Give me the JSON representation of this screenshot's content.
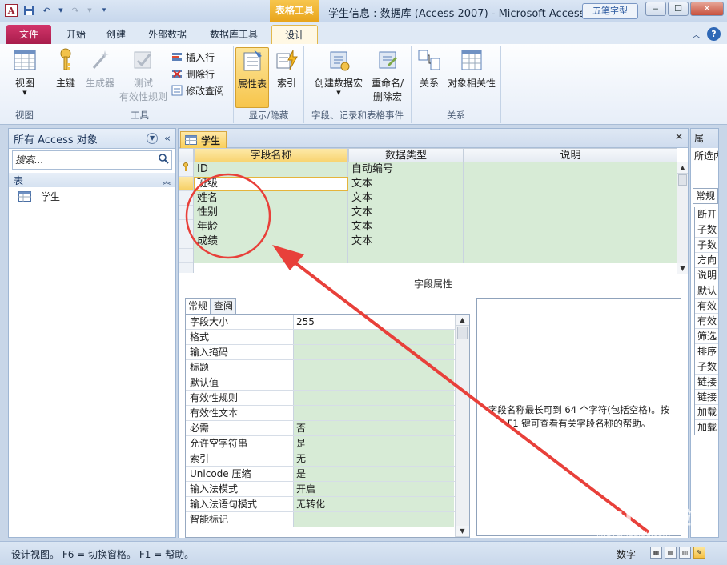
{
  "window": {
    "title": "学生信息 : 数据库 (Access 2007)  -  Microsoft Access",
    "context_tab_group": "表格工具",
    "input_method_logo": "五笔字型",
    "app_icon": "A",
    "minimize": "‒",
    "maximize": "☐",
    "close": "✕"
  },
  "quick_access": {
    "save_icon": "save-icon",
    "undo_icon": "undo-icon",
    "redo_icon": "redo-icon",
    "customize_icon": "customize-qat-icon"
  },
  "tabs": [
    "文件",
    "开始",
    "创建",
    "外部数据",
    "数据库工具",
    "设计"
  ],
  "ribbon": {
    "views_group": {
      "label": "视图",
      "view_button": "视图"
    },
    "tools_group": {
      "label": "工具",
      "primary_key": "主键",
      "builder": "生成器",
      "test_validation_line1": "测试",
      "test_validation_line2": "有效性规则",
      "insert_rows": "插入行",
      "delete_rows": "删除行",
      "modify_lookups": "修改查阅"
    },
    "show_hide_group": {
      "label": "显示/隐藏",
      "property_sheet": "属性表",
      "indexes": "索引"
    },
    "events_group": {
      "label": "字段、记录和表格事件",
      "create_macro": "创建数据宏",
      "rename_delete_macro_line1": "重命名/",
      "rename_delete_macro_line2": "删除宏"
    },
    "relationships_group": {
      "label": "关系",
      "relationships": "关系",
      "object_dependencies": "对象相关性"
    }
  },
  "nav_pane": {
    "title": "所有 Access 对象",
    "search_placeholder": "搜索...",
    "category": "表",
    "items": [
      "学生"
    ]
  },
  "document": {
    "tab_title": "学生",
    "columns": [
      "字段名称",
      "数据类型",
      "说明"
    ],
    "rows": [
      {
        "name": "ID",
        "type": "自动编号",
        "desc": "",
        "primary_key": true
      },
      {
        "name": "班级",
        "type": "文本",
        "desc": "",
        "current": true
      },
      {
        "name": "姓名",
        "type": "文本",
        "desc": ""
      },
      {
        "name": "性别",
        "type": "文本",
        "desc": ""
      },
      {
        "name": "年龄",
        "type": "文本",
        "desc": ""
      },
      {
        "name": "成绩",
        "type": "文本",
        "desc": ""
      }
    ],
    "field_properties_label": "字段属性",
    "property_tabs": [
      "常规",
      "查阅"
    ],
    "properties": [
      {
        "name": "字段大小",
        "value": "255"
      },
      {
        "name": "格式",
        "value": ""
      },
      {
        "name": "输入掩码",
        "value": ""
      },
      {
        "name": "标题",
        "value": ""
      },
      {
        "name": "默认值",
        "value": ""
      },
      {
        "name": "有效性规则",
        "value": ""
      },
      {
        "name": "有效性文本",
        "value": ""
      },
      {
        "name": "必需",
        "value": "否"
      },
      {
        "name": "允许空字符串",
        "value": "是"
      },
      {
        "name": "索引",
        "value": "无"
      },
      {
        "name": "Unicode 压缩",
        "value": "是"
      },
      {
        "name": "输入法模式",
        "value": "开启"
      },
      {
        "name": "输入法语句模式",
        "value": "无转化"
      },
      {
        "name": "智能标记",
        "value": ""
      }
    ],
    "help_text": "字段名称最长可到 64 个字符(包括空格)。按 F1 键可查看有关字段名称的帮助。"
  },
  "property_sheet": {
    "title": "属",
    "selection_type": "所选内",
    "tab": "常规",
    "items": [
      "断开",
      "子数",
      "子数",
      "方向",
      "说明",
      "默认",
      "有效",
      "有效",
      "筛选",
      "排序",
      "子数",
      "链接",
      "链接",
      "加载",
      "加载"
    ]
  },
  "status_bar": {
    "text": "设计视图。   F6 = 切换窗格。   F1 = 帮助。",
    "mode": "数字"
  },
  "watermark": {
    "brand": "Baidu 经验",
    "url": "jingyan.baidu.com"
  },
  "colors": {
    "file_tab": "#c22a5c",
    "context_tab": "#f0b43a",
    "annotation_red": "#e8403a",
    "green_cell": "#d7ebd6"
  }
}
